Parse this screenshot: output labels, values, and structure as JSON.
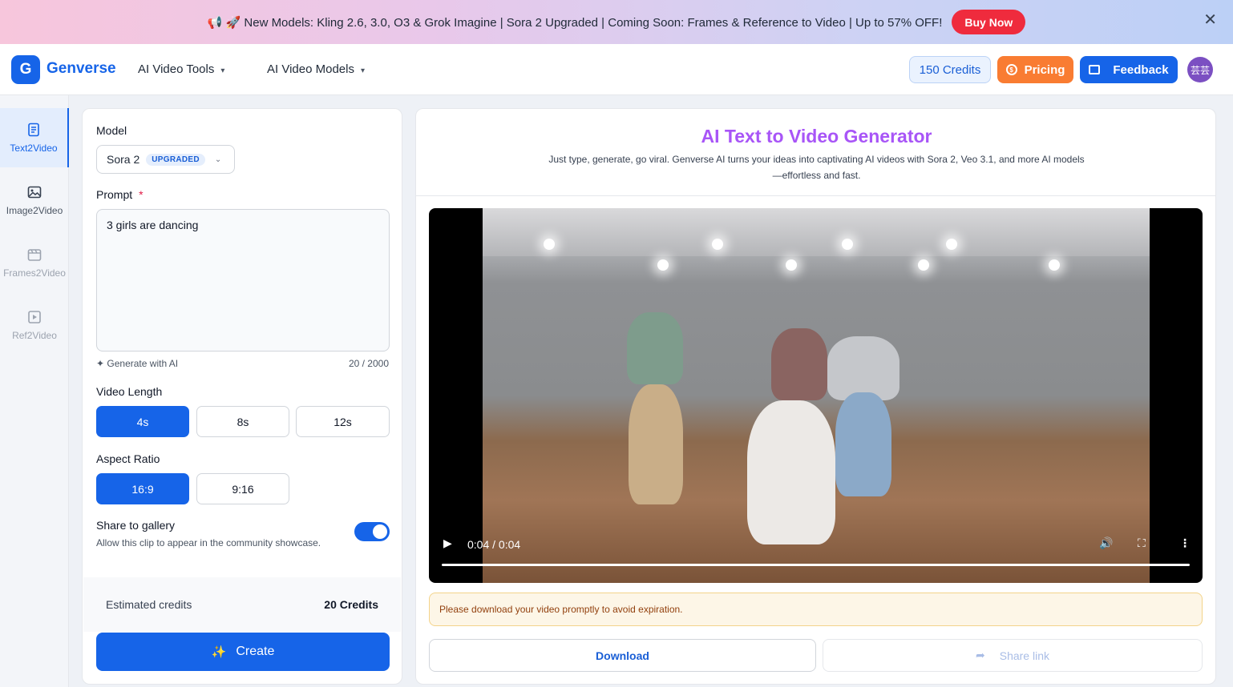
{
  "banner": {
    "text": "📢 🚀 New Models: Kling 2.6, 3.0, O3 & Grok Imagine | Sora 2 Upgraded | Coming Soon: Frames & Reference to Video | Up to 57% OFF!",
    "buy_label": "Buy Now",
    "close_glyph": "✕"
  },
  "header": {
    "logo_letter": "G",
    "brand": "Genverse",
    "nav": [
      {
        "label": "AI Video Tools"
      },
      {
        "label": "AI Video Models"
      }
    ],
    "chevron": "⌄",
    "credits_label": "150 Credits",
    "pricing_label": "Pricing",
    "feedback_label": "Feedback",
    "avatar_text": "芸芸",
    "accent": "#1664e8"
  },
  "sidebar": {
    "items": [
      {
        "label": "Text2Video",
        "icon": "document-icon"
      },
      {
        "label": "Image2Video",
        "icon": "image-icon"
      },
      {
        "label": "Frames2Video",
        "icon": "frames-icon"
      },
      {
        "label": "Ref2Video",
        "icon": "play-square-icon"
      }
    ]
  },
  "form": {
    "model_label": "Model",
    "model_value": "Sora 2",
    "model_badge": "UPGRADED",
    "prompt_label": "Prompt",
    "required_mark": "*",
    "prompt_value": "3 girls are dancing",
    "generate_ai_label": "Generate with AI",
    "char_count": "20 / 2000",
    "length_label": "Video Length",
    "length_options": [
      "4s",
      "8s",
      "12s"
    ],
    "length_selected": "4s",
    "ratio_label": "Aspect Ratio",
    "ratio_options": [
      "16:9",
      "9:16"
    ],
    "ratio_selected": "16:9",
    "share_title": "Share to gallery",
    "share_desc": "Allow this clip to appear in the community showcase.",
    "share_enabled": true,
    "estimated_label": "Estimated credits",
    "estimated_value": "20 Credits",
    "create_label": "Create"
  },
  "result": {
    "title": "AI Text to Video Generator",
    "subtitle": "Just type, generate, go viral. Genverse AI turns your ideas into captivating AI videos with Sora 2, Veo 3.1, and more AI models—effortless and fast.",
    "video_time": "0:04 / 0:04",
    "progress": 1.0,
    "notice": "Please download your video promptly to avoid expiration.",
    "download_label": "Download",
    "share_link_label": "Share link"
  }
}
